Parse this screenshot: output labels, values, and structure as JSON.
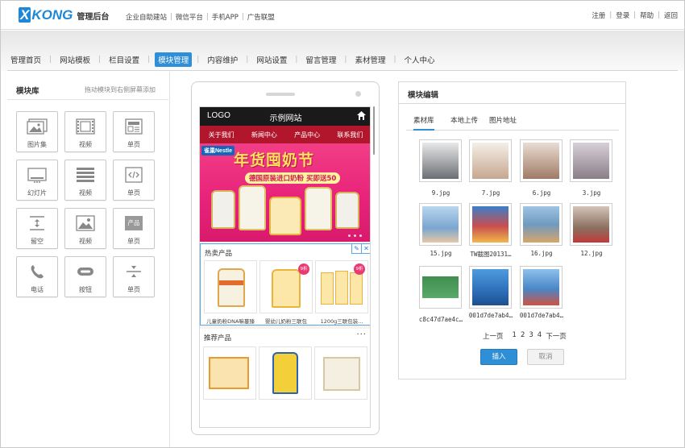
{
  "header": {
    "brand": "XKONG",
    "subtitle": "管理后台",
    "links": [
      "企业自助建站",
      "微信平台",
      "手机APP",
      "广告联盟"
    ],
    "right_links": [
      "注册",
      "登录",
      "帮助",
      "返回"
    ]
  },
  "nav": {
    "items": [
      "管理首页",
      "网站模板",
      "栏目设置",
      "模块管理",
      "内容维护",
      "网站设置",
      "留言管理",
      "素材管理",
      "个人中心"
    ],
    "active_index": 3
  },
  "library": {
    "title": "模块库",
    "hint": "拖动模块到右侧屏幕添加",
    "tiles": [
      {
        "label": "图片集",
        "icon": "image-gallery-icon"
      },
      {
        "label": "视频",
        "icon": "film-icon"
      },
      {
        "label": "单页",
        "icon": "page-icon"
      },
      {
        "label": "幻灯片",
        "icon": "slideshow-icon"
      },
      {
        "label": "视频",
        "icon": "list-icon"
      },
      {
        "label": "单页",
        "icon": "code-icon"
      },
      {
        "label": "留空",
        "icon": "spacer-icon"
      },
      {
        "label": "视频",
        "icon": "picture-icon"
      },
      {
        "label": "单页",
        "icon": "product-icon",
        "icon_text": "产品"
      },
      {
        "label": "电话",
        "icon": "phone-icon"
      },
      {
        "label": "按钮",
        "icon": "button-icon"
      },
      {
        "label": "单页",
        "icon": "divider-icon"
      }
    ]
  },
  "phone": {
    "logo": "LOGO",
    "site_name": "示例网站",
    "nav": [
      "关于我们",
      "新闻中心",
      "产品中心",
      "联系我们"
    ],
    "banner": {
      "brand": "雀巢Nestle",
      "headline": "年货囤奶节",
      "promo": "德国原装进口奶粉 买即送50"
    },
    "hot": {
      "title": "热卖产品",
      "products": [
        {
          "name": "儿童奶粉DNA嘛蔓臻",
          "badge": ""
        },
        {
          "name": "婴幼儿奶粉三联包",
          "badge": "9折"
        },
        {
          "name": "1200g三联包装...",
          "badge": "9折"
        }
      ]
    },
    "recommend": {
      "title": "推荐产品",
      "more": "···"
    }
  },
  "editor": {
    "title": "模块编辑",
    "tabs": [
      "素材库",
      "本地上传",
      "图片地址"
    ],
    "active_tab": 0,
    "images": [
      {
        "name": "9.jpg",
        "color": "#6b6f74"
      },
      {
        "name": "7.jpg",
        "color": "#c7a78f"
      },
      {
        "name": "6.jpg",
        "color": "#a07a66"
      },
      {
        "name": "3.jpg",
        "color": "#8a7e88"
      },
      {
        "name": "15.jpg",
        "color": "#7aa6cf"
      },
      {
        "name": "TW截图20131…",
        "color": "#c94f4f"
      },
      {
        "name": "16.jpg",
        "color": "#6f9abf"
      },
      {
        "name": "12.jpg",
        "color": "#8a6f5f"
      },
      {
        "name": "c8c47d7ae4c…",
        "color": "#3f8f4f"
      },
      {
        "name": "001d7de7ab4…",
        "color": "#2d6fb8"
      },
      {
        "name": "001d7de7ab4…",
        "color": "#4a86c7"
      }
    ],
    "pager": {
      "prev": "上一页",
      "pages": [
        "1",
        "2",
        "3",
        "4"
      ],
      "next": "下一页"
    },
    "confirm": "插入",
    "cancel": "取消"
  },
  "colors": {
    "accent": "#2f8fd6",
    "mobile_nav": "#b2162c",
    "banner": "#e8237a"
  }
}
